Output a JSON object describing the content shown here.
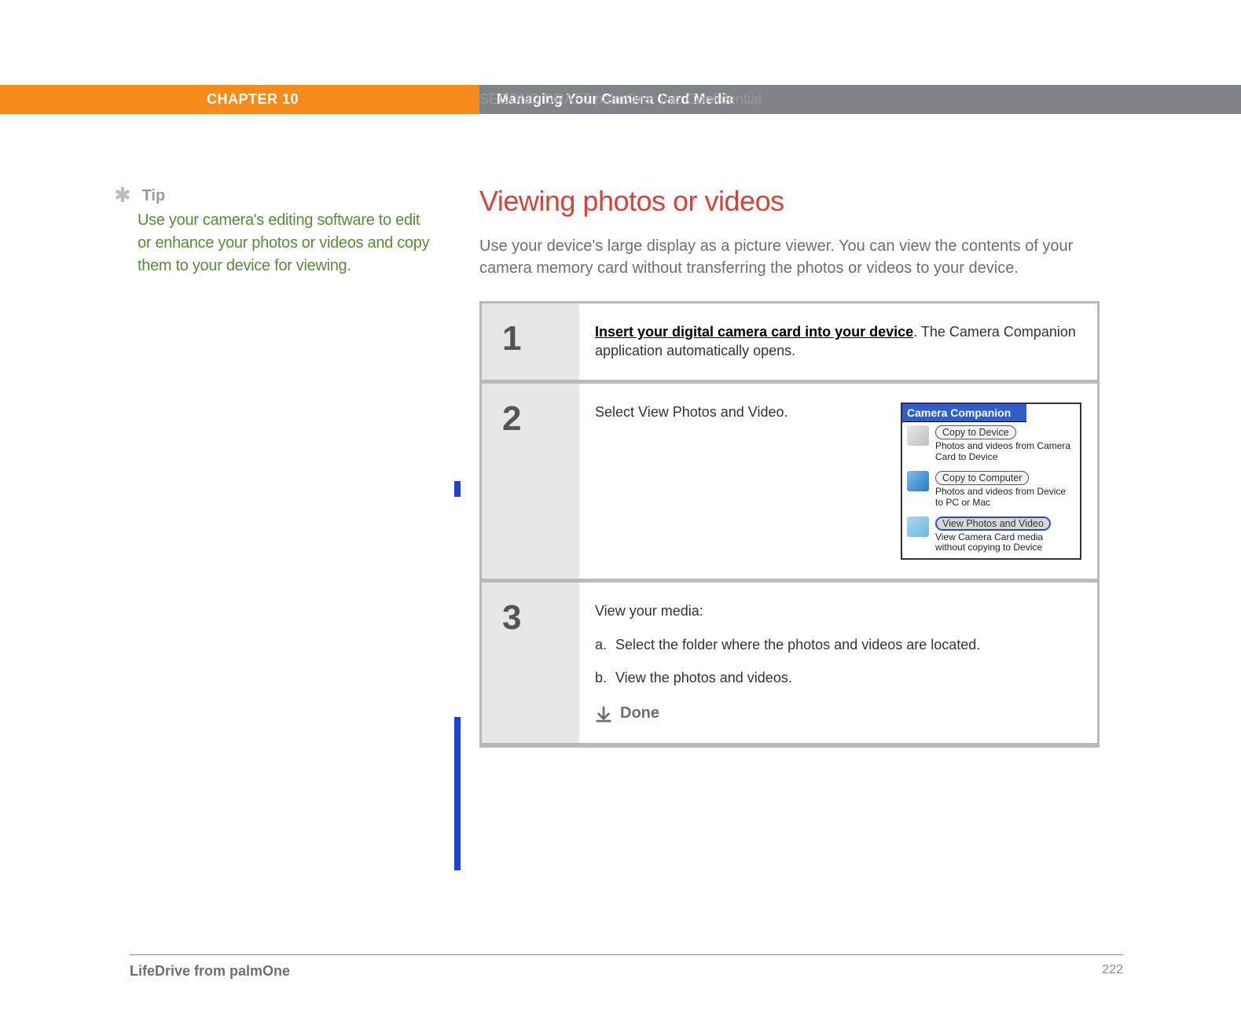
{
  "watermark": "SECOND DRAFT palmOne, Inc.  Confidential",
  "banner": {
    "chapter": "CHAPTER 10",
    "title": "Managing Your Camera Card Media"
  },
  "tip": {
    "label": "Tip",
    "body": "Use your camera's editing software to edit or enhance your photos or videos and copy them to your device for viewing."
  },
  "page_title": "Viewing photos or videos",
  "intro": "Use your device's large display as a picture viewer. You can view the contents of your camera memory card without transferring the photos or videos to your device.",
  "steps": [
    {
      "num": "1",
      "link_text": "Insert your digital camera card into your device",
      "rest": ". The Camera Companion application automatically opens."
    },
    {
      "num": "2",
      "text": "Select View Photos and Video."
    },
    {
      "num": "3",
      "heading": "View your media:",
      "items": [
        {
          "letter": "a.",
          "text": "Select the folder where the photos and videos are located."
        },
        {
          "letter": "b.",
          "text": "View the photos and videos."
        }
      ],
      "done": "Done"
    }
  ],
  "cc_app": {
    "title": "Camera Companion",
    "rows": [
      {
        "button": "Copy to Device",
        "sub": "Photos and videos from Camera Card to Device",
        "selected": false
      },
      {
        "button": "Copy to Computer",
        "sub": "Photos and videos from Device to PC or Mac",
        "selected": false
      },
      {
        "button": "View Photos and Video",
        "sub": "View Camera Card media without copying to Device",
        "selected": true
      }
    ]
  },
  "footer": {
    "left": "LifeDrive from palmOne",
    "page": "222"
  }
}
